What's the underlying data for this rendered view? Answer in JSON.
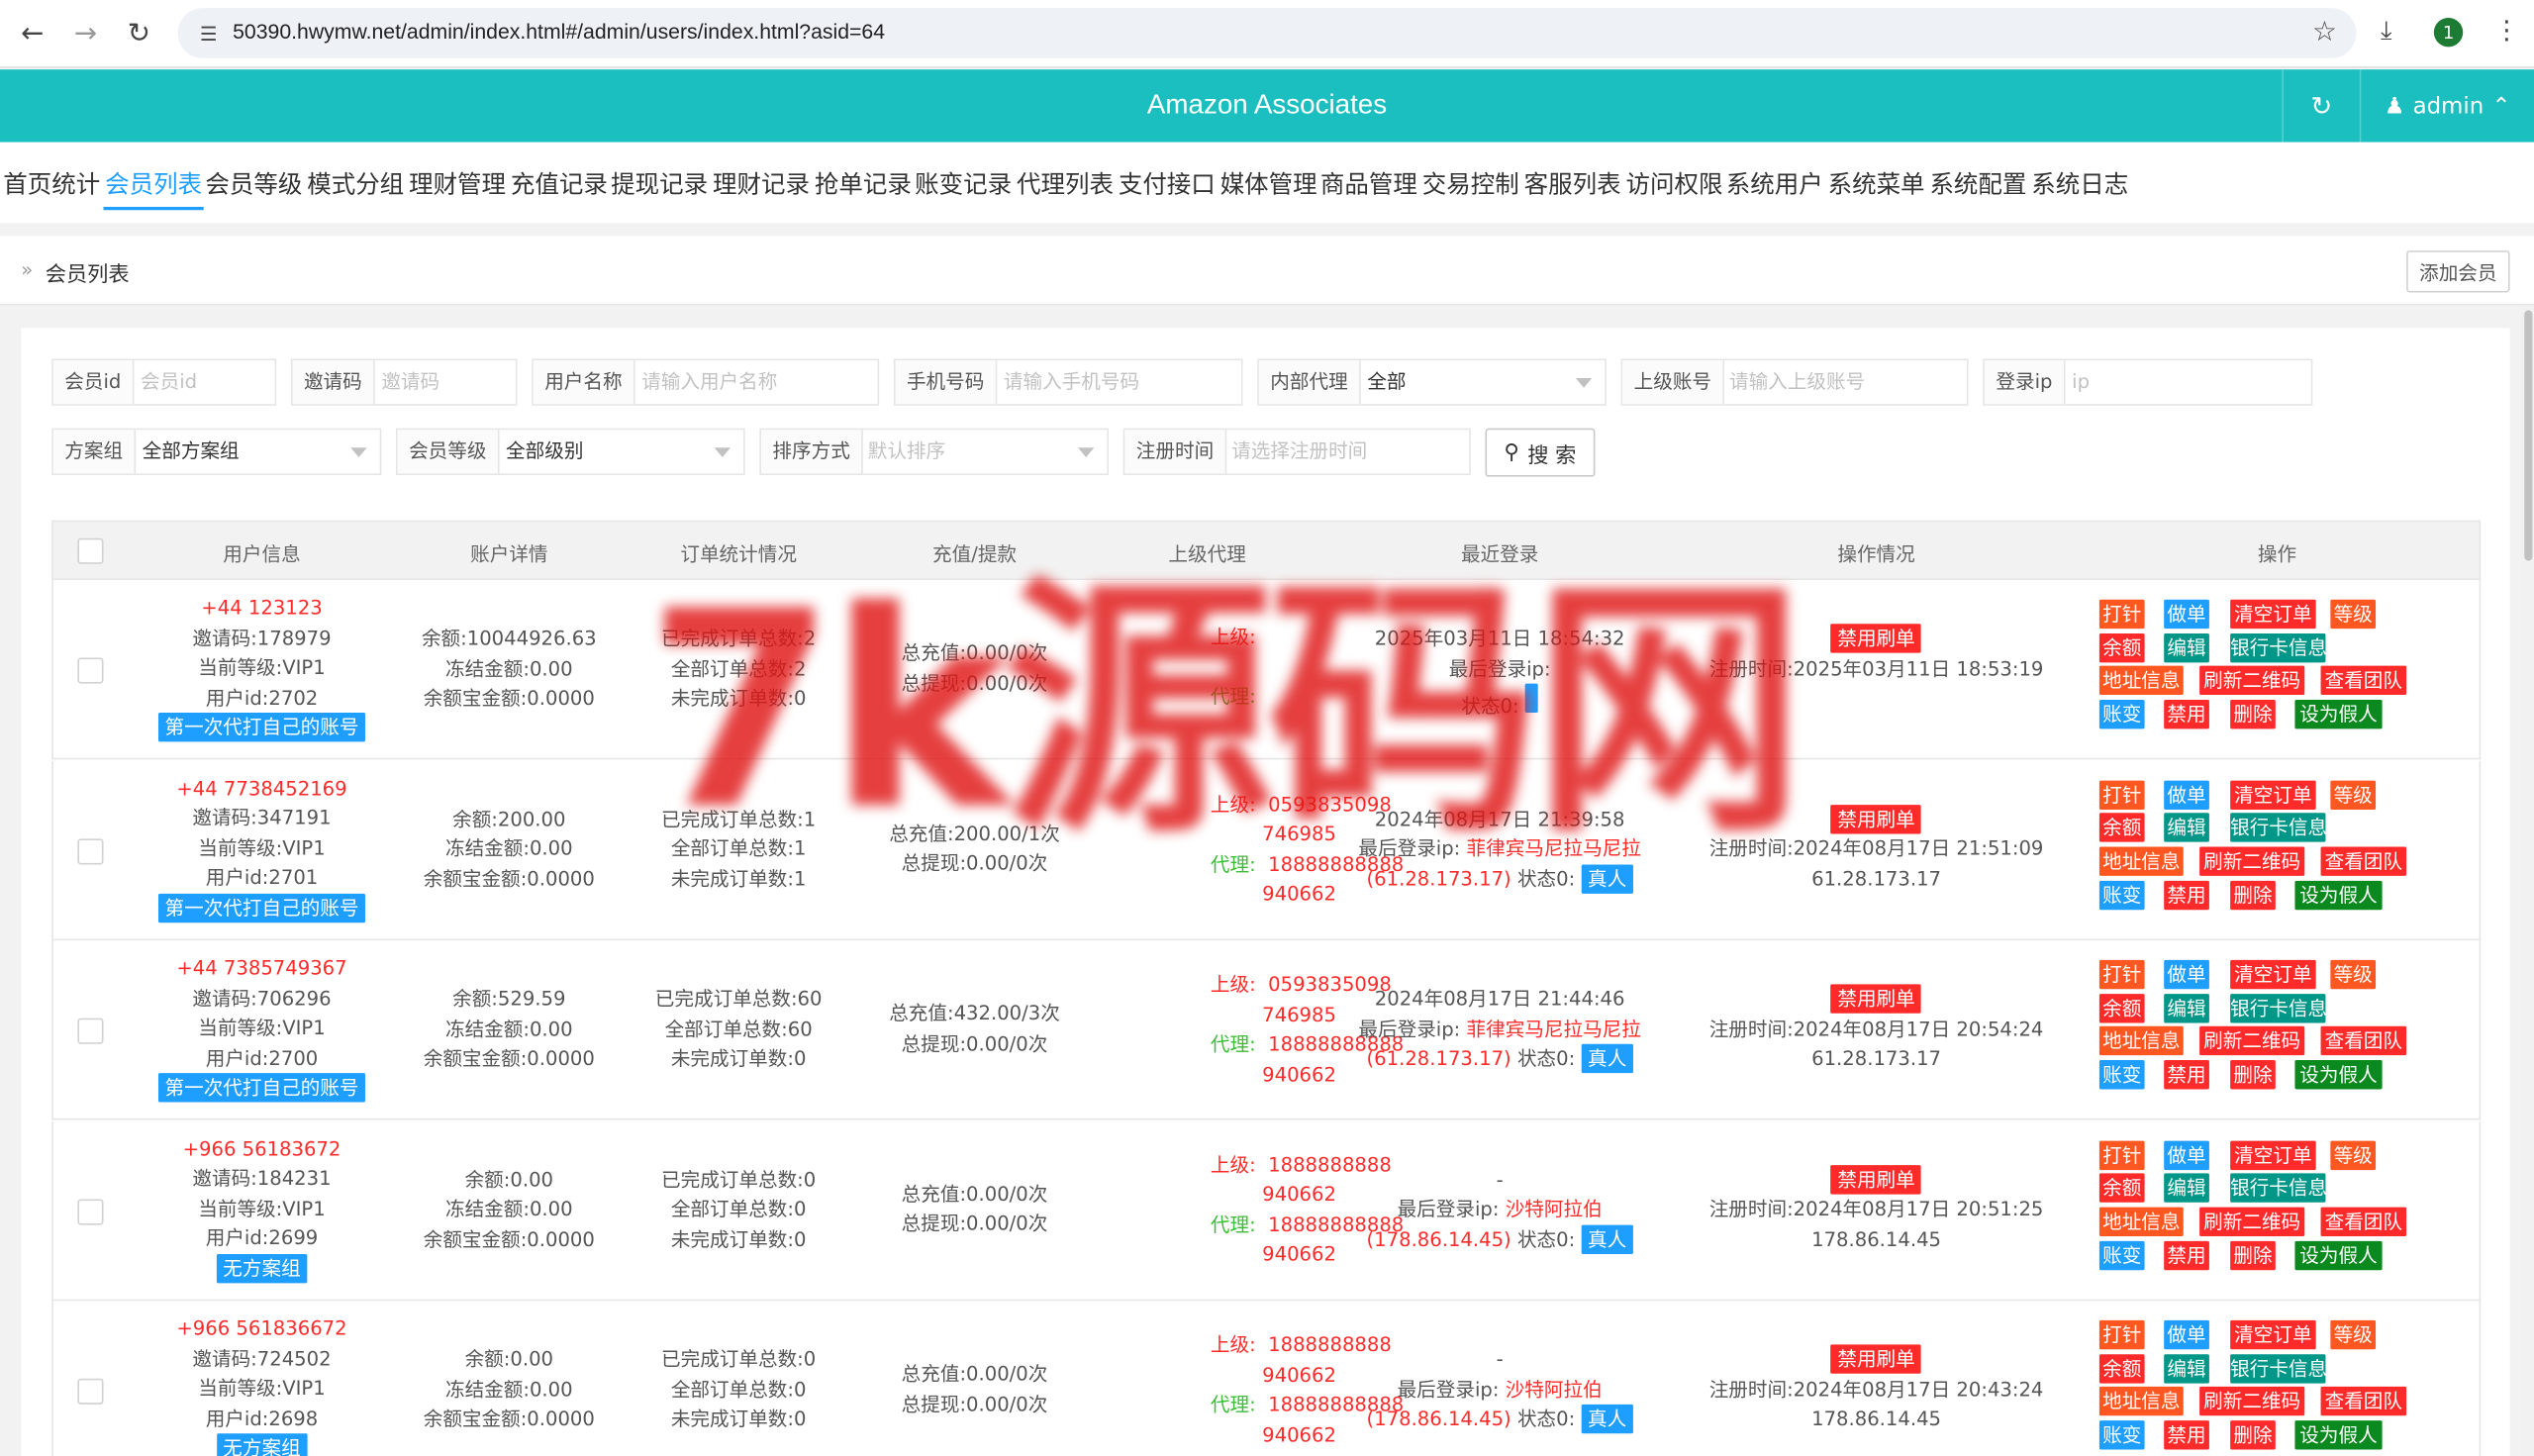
{
  "browser": {
    "url": "50390.hwymw.net/admin/index.html#/admin/users/index.html?asid=64",
    "profile_initial": "1"
  },
  "header": {
    "title": "Amazon Associates",
    "user": "admin"
  },
  "menu": [
    "首页统计",
    "会员列表",
    "会员等级",
    "模式分组",
    "理财管理",
    "充值记录",
    "提现记录",
    "理财记录",
    "抢单记录",
    "账变记录",
    "代理列表",
    "支付接口",
    "媒体管理",
    "商品管理",
    "交易控制",
    "客服列表",
    "访问权限",
    "系统用户",
    "系统菜单",
    "系统配置",
    "系统日志"
  ],
  "breadcrumb": "会员列表",
  "add_button": "添加会员",
  "filters": {
    "member_id": {
      "label": "会员id",
      "placeholder": "会员id"
    },
    "invite_code": {
      "label": "邀请码",
      "placeholder": "邀请码"
    },
    "username": {
      "label": "用户名称",
      "placeholder": "请输入用户名称"
    },
    "phone": {
      "label": "手机号码",
      "placeholder": "请输入手机号码"
    },
    "internal_agent": {
      "label": "内部代理",
      "value": "全部"
    },
    "parent_account": {
      "label": "上级账号",
      "placeholder": "请输入上级账号"
    },
    "login_ip": {
      "label": "登录ip",
      "placeholder": "ip"
    },
    "plan_group": {
      "label": "方案组",
      "value": "全部方案组"
    },
    "member_level": {
      "label": "会员等级",
      "value": "全部级别"
    },
    "sort": {
      "label": "排序方式",
      "placeholder": "默认排序"
    },
    "reg_time": {
      "label": "注册时间",
      "placeholder": "请选择注册时间"
    },
    "search_label": "搜 索"
  },
  "table": {
    "headers": [
      "用户信息",
      "账户详情",
      "订单统计情况",
      "充值/提款",
      "上级代理",
      "最近登录",
      "操作情况",
      "操作"
    ],
    "rows": [
      {
        "phone": "+44   123123",
        "invite": "邀请码:178979",
        "level": "当前等级:VIP1",
        "uid": "用户id:2702",
        "tag": "第一次代打自己的账号",
        "balance": "余额:10044926.63",
        "frozen": "冻结金额:0.00",
        "treasure": "余额宝金额:0.0000",
        "order_done": "已完成订单总数:2",
        "order_all": "全部订单总数:2",
        "order_undone": "未完成订单数:0",
        "recharge": "总充值:0.00/0次",
        "withdraw": "总提现:0.00/0次",
        "parent_label": "上级:",
        "parent_account": "",
        "parent_code": "",
        "agent_label": "代理:",
        "agent_account": "",
        "agent_code": "",
        "last_login_time": "2025年03月11日 18:54:32",
        "last_login_ip": "最后登录ip:",
        "last_login_ip2": "",
        "last_login_loc": "",
        "login_status": "状态0:",
        "login_tag": "",
        "op_tag": "禁用刷单",
        "reg_time": "注册时间:2025年03月11日 18:53:19",
        "reg_ip": ""
      },
      {
        "phone": "+44   7738452169",
        "invite": "邀请码:347191",
        "level": "当前等级:VIP1",
        "uid": "用户id:2701",
        "tag": "第一次代打自己的账号",
        "balance": "余额:200.00",
        "frozen": "冻结金额:0.00",
        "treasure": "余额宝金额:0.0000",
        "order_done": "已完成订单总数:1",
        "order_all": "全部订单总数:1",
        "order_undone": "未完成订单数:1",
        "recharge": "总充值:200.00/1次",
        "withdraw": "总提现:0.00/0次",
        "parent_label": "上级:",
        "parent_account": "0593835098",
        "parent_code": "746985",
        "agent_label": "代理:",
        "agent_account": "18888888888",
        "agent_code": "940662",
        "last_login_time": "2024年08月17日 21:39:58",
        "last_login_ip": "最后登录ip:",
        "last_login_ip2": "(61.28.173.17)",
        "last_login_loc": "菲律宾马尼拉马尼拉",
        "login_status": "状态0:",
        "login_tag": "真人",
        "op_tag": "禁用刷单",
        "reg_time": "注册时间:2024年08月17日 21:51:09",
        "reg_ip": "61.28.173.17"
      },
      {
        "phone": "+44   7385749367",
        "invite": "邀请码:706296",
        "level": "当前等级:VIP1",
        "uid": "用户id:2700",
        "tag": "第一次代打自己的账号",
        "balance": "余额:529.59",
        "frozen": "冻结金额:0.00",
        "treasure": "余额宝金额:0.0000",
        "order_done": "已完成订单总数:60",
        "order_all": "全部订单总数:60",
        "order_undone": "未完成订单数:0",
        "recharge": "总充值:432.00/3次",
        "withdraw": "总提现:0.00/0次",
        "parent_label": "上级:",
        "parent_account": "0593835098",
        "parent_code": "746985",
        "agent_label": "代理:",
        "agent_account": "18888888888",
        "agent_code": "940662",
        "last_login_time": "2024年08月17日 21:44:46",
        "last_login_ip": "最后登录ip:",
        "last_login_ip2": "(61.28.173.17)",
        "last_login_loc": "菲律宾马尼拉马尼拉",
        "login_status": "状态0:",
        "login_tag": "真人",
        "op_tag": "禁用刷单",
        "reg_time": "注册时间:2024年08月17日 20:54:24",
        "reg_ip": "61.28.173.17"
      },
      {
        "phone": "+966   56183672",
        "invite": "邀请码:184231",
        "level": "当前等级:VIP1",
        "uid": "用户id:2699",
        "tag": "无方案组",
        "balance": "余额:0.00",
        "frozen": "冻结金额:0.00",
        "treasure": "余额宝金额:0.0000",
        "order_done": "已完成订单总数:0",
        "order_all": "全部订单总数:0",
        "order_undone": "未完成订单数:0",
        "recharge": "总充值:0.00/0次",
        "withdraw": "总提现:0.00/0次",
        "parent_label": "上级:",
        "parent_account": "1888888888",
        "parent_code": "940662",
        "agent_label": "代理:",
        "agent_account": "18888888888",
        "agent_code": "940662",
        "last_login_time": "-",
        "last_login_ip": "最后登录ip:",
        "last_login_ip2": "(178.86.14.45)",
        "last_login_loc": "沙特阿拉伯",
        "login_status": "状态0:",
        "login_tag": "真人",
        "op_tag": "禁用刷单",
        "reg_time": "注册时间:2024年08月17日 20:51:25",
        "reg_ip": "178.86.14.45"
      },
      {
        "phone": "+966   561836672",
        "invite": "邀请码:724502",
        "level": "当前等级:VIP1",
        "uid": "用户id:2698",
        "tag": "无方案组",
        "balance": "余额:0.00",
        "frozen": "冻结金额:0.00",
        "treasure": "余额宝金额:0.0000",
        "order_done": "已完成订单总数:0",
        "order_all": "全部订单总数:0",
        "order_undone": "未完成订单数:0",
        "recharge": "总充值:0.00/0次",
        "withdraw": "总提现:0.00/0次",
        "parent_label": "上级:",
        "parent_account": "1888888888",
        "parent_code": "940662",
        "agent_label": "代理:",
        "agent_account": "18888888888",
        "agent_code": "940662",
        "last_login_time": "-",
        "last_login_ip": "最后登录ip:",
        "last_login_ip2": "(178.86.14.45)",
        "last_login_loc": "沙特阿拉伯",
        "login_status": "状态0:",
        "login_tag": "真人",
        "op_tag": "禁用刷单",
        "reg_time": "注册时间:2024年08月17日 20:43:24",
        "reg_ip": "178.86.14.45"
      }
    ],
    "ops": [
      "打针",
      "做单",
      "清空订单",
      "等级",
      "余额",
      "编辑",
      "银行卡信息",
      "地址信息",
      "刷新二维码",
      "查看团队",
      "账变",
      "禁用",
      "删除",
      "设为假人"
    ]
  },
  "watermark": "7k源码网",
  "colors": {
    "accent": "#1bbfbf",
    "link": "#1e9fff",
    "danger": "#ff2a2a",
    "warning": "#ff5722",
    "teal": "#009688",
    "success": "#0a8a1e"
  }
}
